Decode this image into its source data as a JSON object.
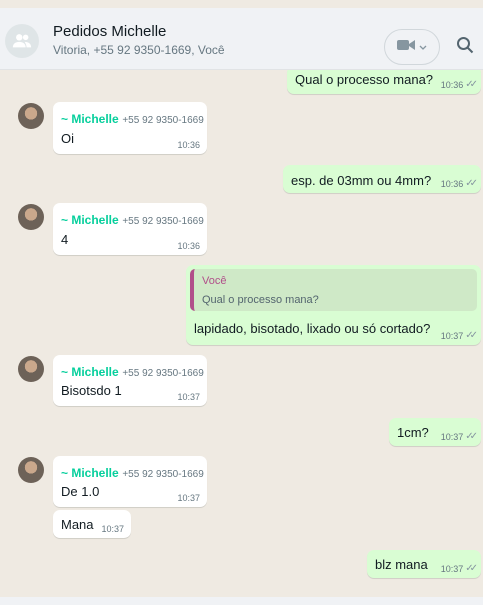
{
  "header": {
    "title": "Pedidos Michelle",
    "subtitle": "Vitoria, +55 92 9350-1669, Você",
    "icons": {
      "group": "group-avatar-icon",
      "video": "video-call-icon",
      "chevron": "chevron-down-icon",
      "search": "search-icon"
    }
  },
  "messages": [
    {
      "dir": "out",
      "text": "Qual o processo mana?",
      "time": "10:36"
    },
    {
      "dir": "in",
      "sender": "~ Michelle",
      "phone": "+55 92 9350-1669",
      "text": "Oi",
      "time": "10:36"
    },
    {
      "dir": "out",
      "text": "esp. de 03mm ou 4mm?",
      "time": "10:36"
    },
    {
      "dir": "in",
      "sender": "~ Michelle",
      "phone": "+55 92 9350-1669",
      "text": "4",
      "time": "10:36"
    },
    {
      "dir": "out",
      "quote_author": "Você",
      "quote_text": "Qual o processo mana?",
      "text": "lapidado, bisotado, lixado ou só cortado?",
      "time": "10:37"
    },
    {
      "dir": "in",
      "sender": "~ Michelle",
      "phone": "+55 92 9350-1669",
      "text": "Bisotsdo 1",
      "time": "10:37"
    },
    {
      "dir": "out",
      "text": "1cm?",
      "time": "10:37"
    },
    {
      "dir": "in",
      "sender": "~ Michelle",
      "phone": "+55 92 9350-1669",
      "text": "De 1.0",
      "time": "10:37"
    },
    {
      "dir": "in",
      "text": "Mana",
      "time": "10:37"
    },
    {
      "dir": "out",
      "text": "blz mana",
      "time": "10:37"
    }
  ]
}
